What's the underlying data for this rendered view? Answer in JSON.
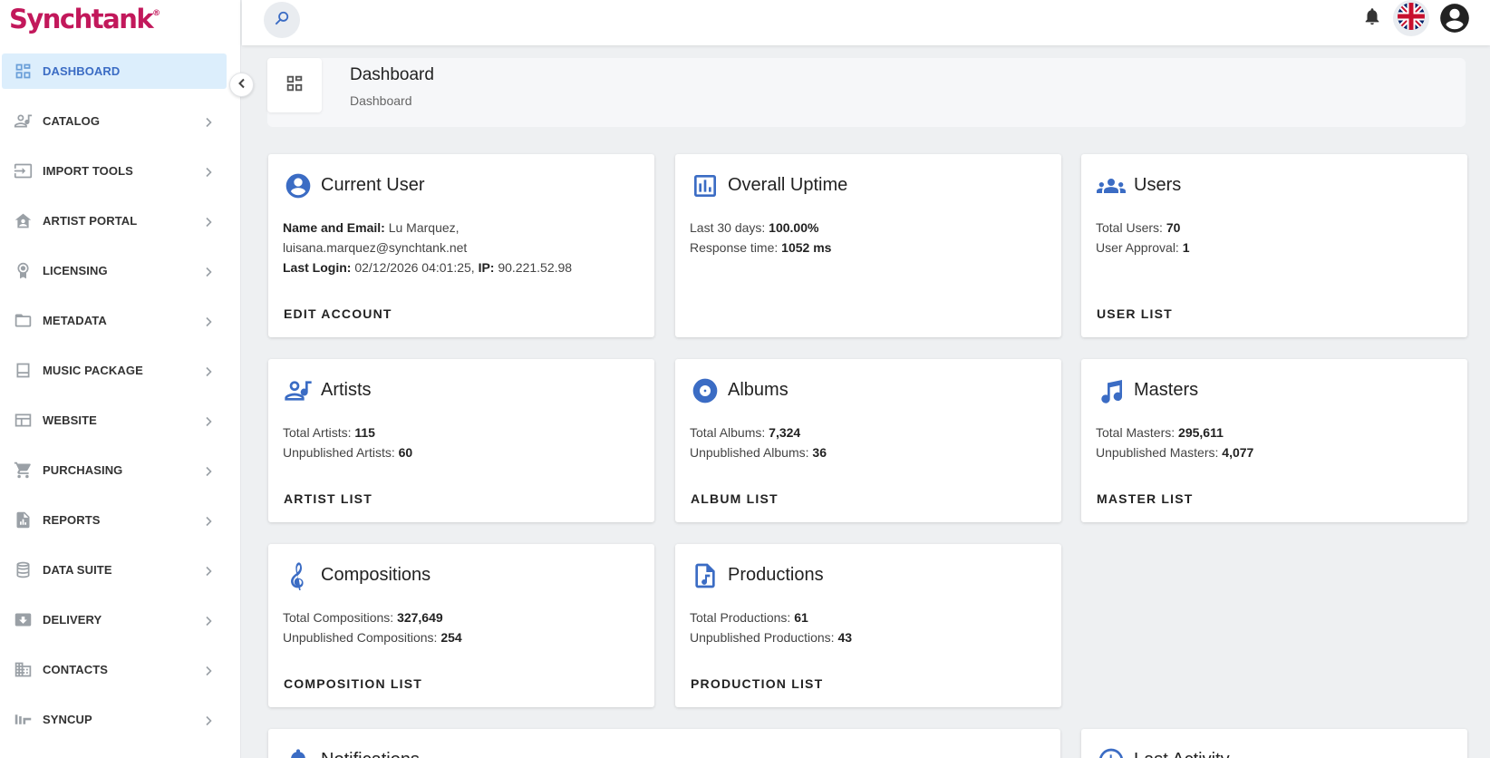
{
  "app": {
    "logo_text": "Synchtank",
    "logo_mark": "®"
  },
  "sidebar": {
    "items": [
      {
        "label": "DASHBOARD",
        "icon": "dashboard-icon",
        "active": true
      },
      {
        "label": "CATALOG",
        "icon": "catalog-icon"
      },
      {
        "label": "IMPORT TOOLS",
        "icon": "import-icon"
      },
      {
        "label": "ARTIST PORTAL",
        "icon": "artist-portal-icon"
      },
      {
        "label": "LICENSING",
        "icon": "licensing-icon"
      },
      {
        "label": "METADATA",
        "icon": "metadata-icon"
      },
      {
        "label": "MUSIC PACKAGE",
        "icon": "music-package-icon"
      },
      {
        "label": "WEBSITE",
        "icon": "website-icon"
      },
      {
        "label": "PURCHASING",
        "icon": "cart-icon"
      },
      {
        "label": "REPORTS",
        "icon": "reports-icon"
      },
      {
        "label": "DATA SUITE",
        "icon": "database-icon"
      },
      {
        "label": "DELIVERY",
        "icon": "delivery-icon"
      },
      {
        "label": "CONTACTS",
        "icon": "contacts-icon"
      },
      {
        "label": "SYNCUP",
        "icon": "syncup-icon"
      }
    ]
  },
  "header": {
    "title": "Dashboard",
    "breadcrumb": "Dashboard"
  },
  "colors": {
    "brand": "#c2185b",
    "accent": "#3b6cc4",
    "active_nav_bg": "#dceefc"
  },
  "cards": {
    "current_user": {
      "title": "Current User",
      "name_email_label": "Name and Email:",
      "name": "Lu Marquez,",
      "email": "luisana.marquez@synchtank.net",
      "last_login_label": "Last Login:",
      "last_login": "02/12/2026 04:01:25,",
      "ip_label": "IP:",
      "ip": "90.221.52.98",
      "action": "EDIT ACCOUNT"
    },
    "uptime": {
      "title": "Overall Uptime",
      "line1_label": "Last 30 days:",
      "line1_value": "100.00%",
      "line2_label": "Response time:",
      "line2_value": "1052 ms"
    },
    "users": {
      "title": "Users",
      "line1_label": "Total Users:",
      "line1_value": "70",
      "line2_label": "User Approval:",
      "line2_value": "1",
      "action": "USER LIST"
    },
    "artists": {
      "title": "Artists",
      "line1_label": "Total Artists:",
      "line1_value": "115",
      "line2_label": "Unpublished Artists:",
      "line2_value": "60",
      "action": "ARTIST LIST"
    },
    "albums": {
      "title": "Albums",
      "line1_label": "Total Albums:",
      "line1_value": "7,324",
      "line2_label": "Unpublished Albums:",
      "line2_value": "36",
      "action": "ALBUM LIST"
    },
    "masters": {
      "title": "Masters",
      "line1_label": "Total Masters:",
      "line1_value": "295,611",
      "line2_label": "Unpublished Masters:",
      "line2_value": "4,077",
      "action": "MASTER LIST"
    },
    "compositions": {
      "title": "Compositions",
      "line1_label": "Total Compositions:",
      "line1_value": "327,649",
      "line2_label": "Unpublished Compositions:",
      "line2_value": "254",
      "action": "COMPOSITION LIST"
    },
    "productions": {
      "title": "Productions",
      "line1_label": "Total Productions:",
      "line1_value": "61",
      "line2_label": "Unpublished Productions:",
      "line2_value": "43",
      "action": "PRODUCTION LIST"
    },
    "notifications": {
      "title": "Notifications"
    },
    "last_activity": {
      "title": "Last Activity"
    }
  }
}
